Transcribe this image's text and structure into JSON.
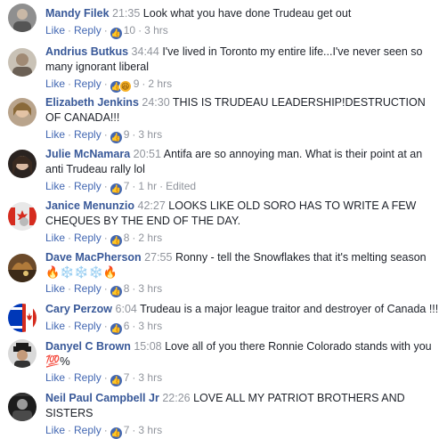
{
  "ui": {
    "like": "Like",
    "reply": "Reply",
    "sep": "·",
    "like_icon": "👍",
    "haha_icon": "😆"
  },
  "comments": [
    {
      "name": "Mandy Filek",
      "ts": "21:35",
      "text": "Look what you have done Trudeau get out",
      "count": "10",
      "age": "3 hrs",
      "edited": ""
    },
    {
      "name": "Andrius Butkus",
      "ts": "34:44",
      "text": "I've lived in Toronto my entire life...I've never seen so many ignorant liberal",
      "count": "9",
      "age": "2 hrs",
      "edited": ""
    },
    {
      "name": "Elizabeth Jenkins",
      "ts": "24:30",
      "text": "THIS IS TRUDEAU LEADERSHIP!DESTRUCTION OF CANADA!!!",
      "count": "9",
      "age": "3 hrs",
      "edited": ""
    },
    {
      "name": "Julie McNamara",
      "ts": "20:51",
      "text": "Antifa are so annoying man. What is their point at an anti Trudeau rally lol",
      "count": "7",
      "age": "1 hr",
      "edited": "Edited"
    },
    {
      "name": "Janice Menunzio",
      "ts": "42:27",
      "text": "LOOKS LIKE OLD SORO HAS TO WRITE A FEW CHEQUES BY THE END OF THE DAY.",
      "count": "8",
      "age": "2 hrs",
      "edited": ""
    },
    {
      "name": "Dave MacPherson",
      "ts": "27:55",
      "text": "Ronny - tell the Snowflakes that it's melting season",
      "emoji_line": "🔥❄️❄️❄️🔥",
      "count": "8",
      "age": "3 hrs",
      "edited": ""
    },
    {
      "name": "Cary Perzow",
      "ts": "6:04",
      "text": "Trudeau is a major league traitor and destroyer of Canada !!!",
      "count": "6",
      "age": "3 hrs",
      "edited": ""
    },
    {
      "name": "Danyel C Brown",
      "ts": "15:08",
      "text": "Love all of you there Ronnie Colorado stands with you",
      "emoji_line": "💯%",
      "count": "7",
      "age": "3 hrs",
      "edited": ""
    },
    {
      "name": "Neil Paul Campbell Jr",
      "ts": "22:26",
      "text": "LOVE ALL MY PATRIOT BROTHERS AND SISTERS",
      "count": "7",
      "age": "3 hrs",
      "edited": ""
    }
  ]
}
